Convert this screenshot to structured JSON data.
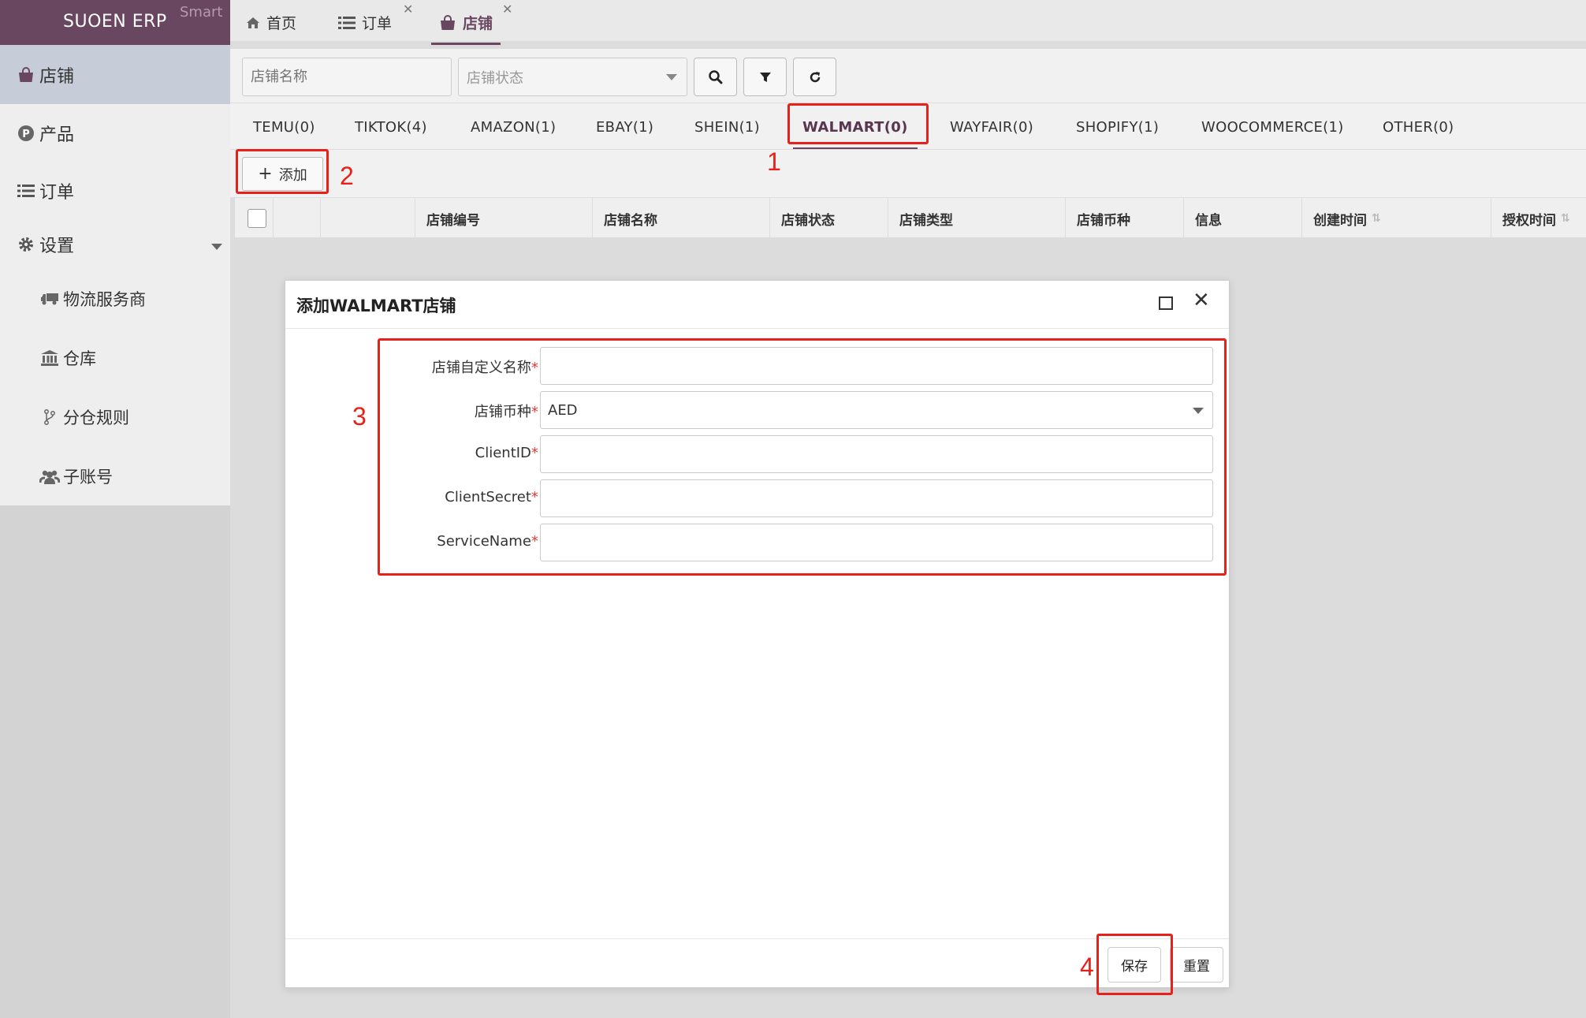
{
  "app": {
    "name": "SUOEN ERP",
    "edition": "Smart"
  },
  "sidebar": {
    "items": [
      {
        "label": "店铺",
        "icon": "shopping-bag-icon"
      },
      {
        "label": "产品",
        "icon": "product-p-icon"
      },
      {
        "label": "订单",
        "icon": "list-icon"
      },
      {
        "label": "设置",
        "icon": "gear-icon"
      },
      {
        "label": "物流服务商",
        "icon": "truck-icon"
      },
      {
        "label": "仓库",
        "icon": "bank-icon"
      },
      {
        "label": "分仓规则",
        "icon": "branch-icon"
      },
      {
        "label": "子账号",
        "icon": "users-icon"
      }
    ]
  },
  "top_tabs": [
    {
      "label": "首页",
      "icon": "home-icon"
    },
    {
      "label": "订单",
      "icon": "list-icon"
    },
    {
      "label": "店铺",
      "icon": "shopping-bag-icon"
    }
  ],
  "toolbar": {
    "search_placeholder": "店铺名称",
    "status_placeholder": "店铺状态"
  },
  "platform_tabs": [
    "TEMU(0)",
    "TIKTOK(4)",
    "AMAZON(1)",
    "EBAY(1)",
    "SHEIN(1)",
    "WALMART(0)",
    "WAYFAIR(0)",
    "SHOPIFY(1)",
    "WOOCOMMERCE(1)",
    "OTHER(0)"
  ],
  "add_button": "添加",
  "table": {
    "columns": [
      "店铺编号",
      "店铺名称",
      "店铺状态",
      "店铺类型",
      "店铺币种",
      "信息",
      "创建时间",
      "授权时间"
    ]
  },
  "dialog": {
    "title": "添加WALMART店铺",
    "fields": [
      {
        "label": "店铺自定义名称",
        "value": ""
      },
      {
        "label": "店铺币种",
        "value": "AED"
      },
      {
        "label": "ClientID",
        "value": ""
      },
      {
        "label": "ClientSecret",
        "value": ""
      },
      {
        "label": "ServiceName",
        "value": ""
      }
    ],
    "required_mark": "*",
    "colon": ":",
    "save_label": "保存",
    "reset_label": "重置"
  },
  "annotations": [
    "1",
    "2",
    "3",
    "4"
  ],
  "colors": {
    "brand": "#6a4760",
    "annotation": "#e8201a",
    "active_menu": "#c6cdd8"
  }
}
